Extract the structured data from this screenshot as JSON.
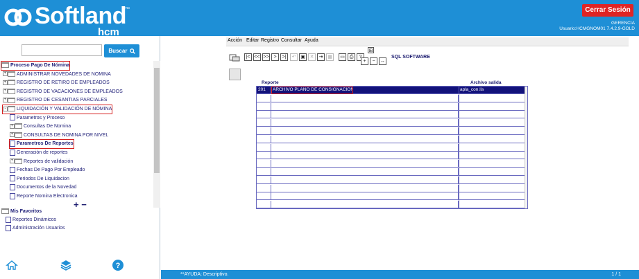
{
  "header": {
    "logo_text": "Softland",
    "logo_tm": "™",
    "logo_sub": "hcm",
    "logout_label": "Cerrar Sesión",
    "company": "GERENCIA",
    "user_line": "Usuario:HCMGNOM01 7.4.2.9-GOLD"
  },
  "sidebar": {
    "search": {
      "button_label": "Buscar",
      "value": ""
    },
    "tree": [
      {
        "label": "Proceso Pago De Nómina",
        "bold": true,
        "highlight": true,
        "icon": "folder-open"
      },
      {
        "label": "ADMINISTRAR NOVEDADES DE NOMINA",
        "icon": "folder",
        "expander": "+"
      },
      {
        "label": "REGISTRO DE RETIRO DE EMPLEADOS",
        "icon": "folder",
        "expander": "+"
      },
      {
        "label": "REGISTRO DE VACACIONES DE EMPLEADOS",
        "icon": "folder",
        "expander": "+"
      },
      {
        "label": "REGISTRO DE CESANTIAS PARCIALES",
        "icon": "folder",
        "expander": "+"
      },
      {
        "label": "LIQUIDACIÓN Y VALIDACIÓN DE NÓMINA",
        "icon": "folder-open",
        "expander": "-",
        "highlight": true
      },
      {
        "label": "Parametros y Proceso",
        "icon": "doc"
      },
      {
        "label": "Consultas De Nomina",
        "icon": "folder",
        "expander": "+"
      },
      {
        "label": "CONSULTAS DE NOMINA POR NIVEL",
        "icon": "folder",
        "expander": "+"
      },
      {
        "label": "Parametros De Reportes",
        "icon": "doc",
        "bold": true,
        "highlight": true
      },
      {
        "label": "Generación de reportes",
        "icon": "doc"
      },
      {
        "label": "Reportes de validación",
        "icon": "folder",
        "expander": "+"
      },
      {
        "label": "Fechas De Pago Por Empleado",
        "icon": "doc"
      },
      {
        "label": "Periodos De Liquidacion",
        "icon": "doc"
      },
      {
        "label": "Documentos de la Novedad",
        "icon": "doc"
      },
      {
        "label": "Reporte Nomina Electronica",
        "icon": "doc"
      }
    ],
    "zoom_plus": "+",
    "zoom_minus": "−",
    "favorites": {
      "title": "Mis Favoritos",
      "items": [
        "Reportes Dinámicos",
        "Administración Usuarios"
      ]
    },
    "footer_icons": [
      "home-icon",
      "layers-icon",
      "help-icon"
    ],
    "help_glyph": "?"
  },
  "menu": [
    "Acción",
    "Editar",
    "Registro",
    "Consultar",
    "Ayuda"
  ],
  "toolbar": {
    "brand": "SQL SOFTWARE"
  },
  "grid": {
    "headers": {
      "reporte": "Reporte",
      "archivo": "Archivo salida"
    },
    "rows": [
      {
        "code": "201",
        "name": "ARCHIVO PLANO DE CONSIGNACION",
        "file": "apla_con.lis",
        "selected": true
      }
    ],
    "empty_rows": 15
  },
  "status": {
    "help": "**AYUDA: Descriptivo.",
    "page": "1 / 1"
  },
  "colors": {
    "brand_blue": "#1e8fd6",
    "logout_red": "#e02424",
    "selection": "#12127a",
    "highlight": "#d61f1f"
  }
}
